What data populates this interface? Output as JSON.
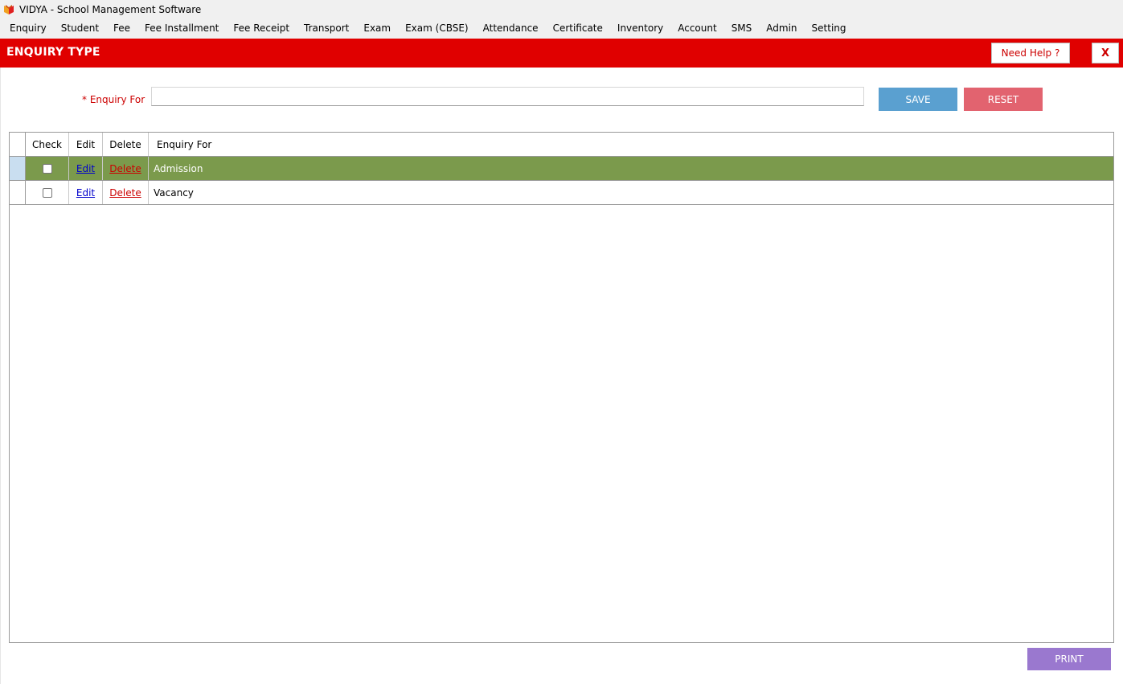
{
  "window": {
    "title": "VIDYA - School Management Software",
    "icon": "vidya-book-logo"
  },
  "menu": [
    "Enquiry",
    "Student",
    "Fee",
    "Fee Installment",
    "Fee Receipt",
    "Transport",
    "Exam",
    "Exam (CBSE)",
    "Attendance",
    "Certificate",
    "Inventory",
    "Account",
    "SMS",
    "Admin",
    "Setting"
  ],
  "header": {
    "title": "ENQUIRY TYPE",
    "help_label": "Need Help ?",
    "close_label": "X",
    "color": "#e00000"
  },
  "form": {
    "enquiry_for_label": "* Enquiry For",
    "enquiry_for_value": "",
    "save_label": "SAVE",
    "reset_label": "RESET"
  },
  "grid": {
    "columns": [
      "Check",
      "Edit",
      "Delete",
      "Enquiry For"
    ],
    "rows": [
      {
        "checked": false,
        "edit": "Edit",
        "delete": "Delete",
        "enquiry_for": "Admission",
        "selected": true
      },
      {
        "checked": false,
        "edit": "Edit",
        "delete": "Delete",
        "enquiry_for": "Vacancy",
        "selected": false
      }
    ],
    "selected_row_color": "#7b9a4c"
  },
  "footer": {
    "print_label": "PRINT"
  }
}
